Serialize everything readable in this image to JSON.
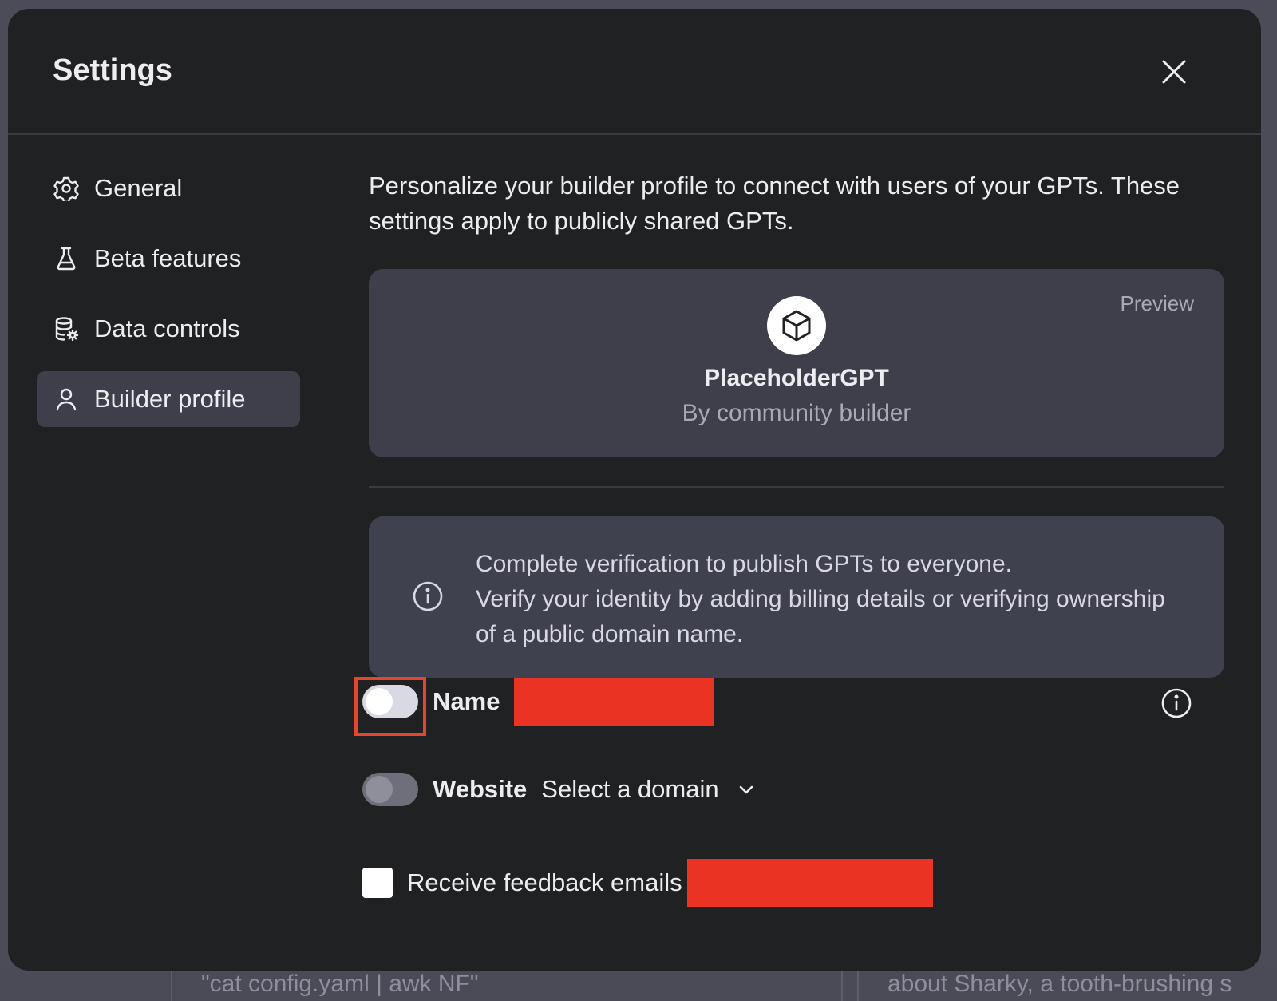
{
  "background": {
    "text_left": "\"cat config.yaml | awk NF\"",
    "text_right": "about Sharky, a tooth-brushing s"
  },
  "modal": {
    "title": "Settings",
    "close_icon": "close-icon"
  },
  "sidebar": {
    "items": [
      {
        "label": "General",
        "icon": "gear-icon"
      },
      {
        "label": "Beta features",
        "icon": "flask-icon"
      },
      {
        "label": "Data controls",
        "icon": "database-icon"
      },
      {
        "label": "Builder profile",
        "icon": "user-icon",
        "active": true
      }
    ]
  },
  "content": {
    "intro": "Personalize your builder profile to connect with users of your GPTs. These settings apply to publicly shared GPTs.",
    "preview": {
      "label": "Preview",
      "gpt_name": "PlaceholderGPT",
      "by": "By community builder"
    },
    "notice": {
      "line1": "Complete verification to publish GPTs to everyone.",
      "line2": "Verify your identity by adding billing details or verifying ownership of a public domain name."
    },
    "name_row": {
      "label": "Name",
      "toggle_on": false
    },
    "website_row": {
      "label": "Website",
      "select_value": "Select a domain",
      "toggle_on": false
    },
    "feedback_row": {
      "label": "Receive feedback emails",
      "checked": false
    }
  },
  "colors": {
    "accent_redaction": "#ea3323",
    "highlight_border": "#e8452c",
    "modal_bg": "#202123",
    "card_bg": "#3e3f4b"
  }
}
